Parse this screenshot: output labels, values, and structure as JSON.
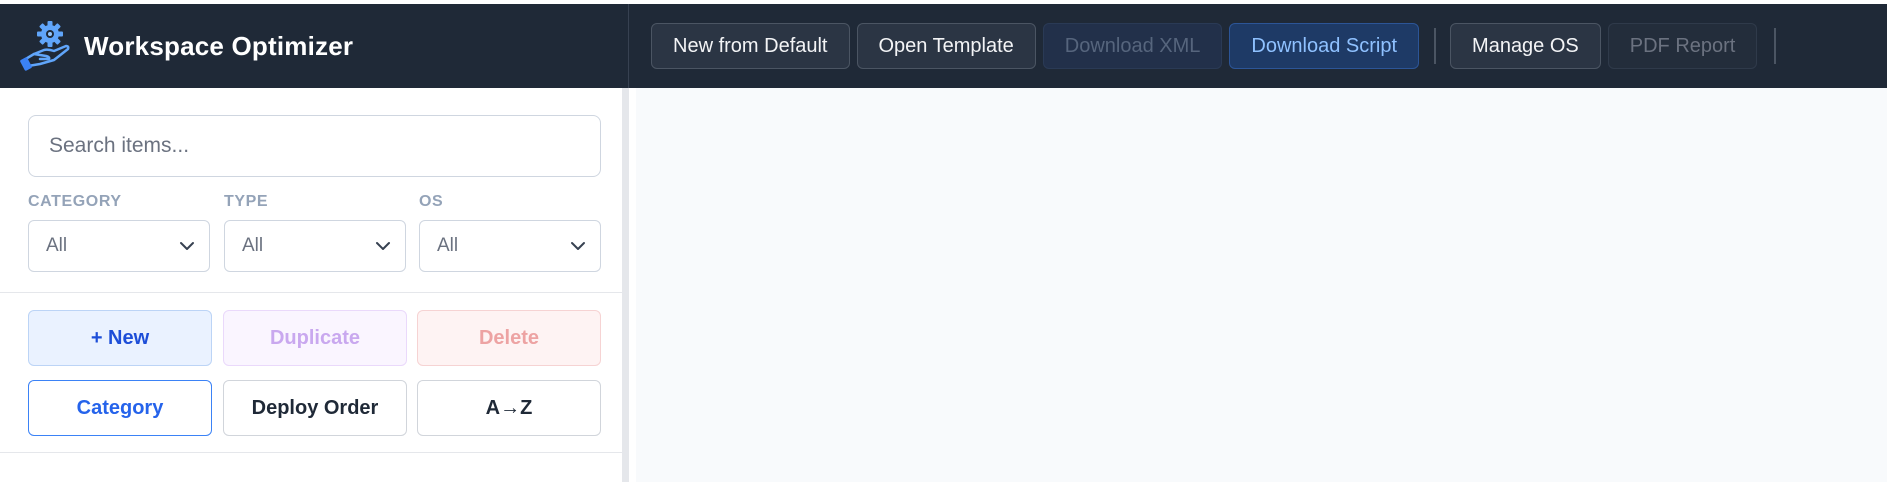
{
  "app": {
    "title": "Workspace Optimizer",
    "logo_icon": "gear-hand-icon"
  },
  "toolbar": {
    "new_from_default": "New from Default",
    "open_template": "Open Template",
    "download_xml": "Download XML",
    "download_script": "Download Script",
    "manage_os": "Manage OS",
    "pdf_report": "PDF Report"
  },
  "sidebar": {
    "search": {
      "placeholder": "Search items...",
      "value": ""
    },
    "filters": [
      {
        "label": "CATEGORY",
        "value": "All"
      },
      {
        "label": "TYPE",
        "value": "All"
      },
      {
        "label": "OS",
        "value": "All"
      }
    ],
    "actions": {
      "new": "+ New",
      "duplicate": "Duplicate",
      "delete": "Delete"
    },
    "sort": {
      "category": "Category",
      "deploy_order": "Deploy Order",
      "alpha": "A→Z"
    }
  },
  "colors": {
    "header_bg": "#1f2937",
    "accent": "#2563eb",
    "primary_button_text": "#8fc1ff",
    "main_bg": "#f8fafc"
  }
}
